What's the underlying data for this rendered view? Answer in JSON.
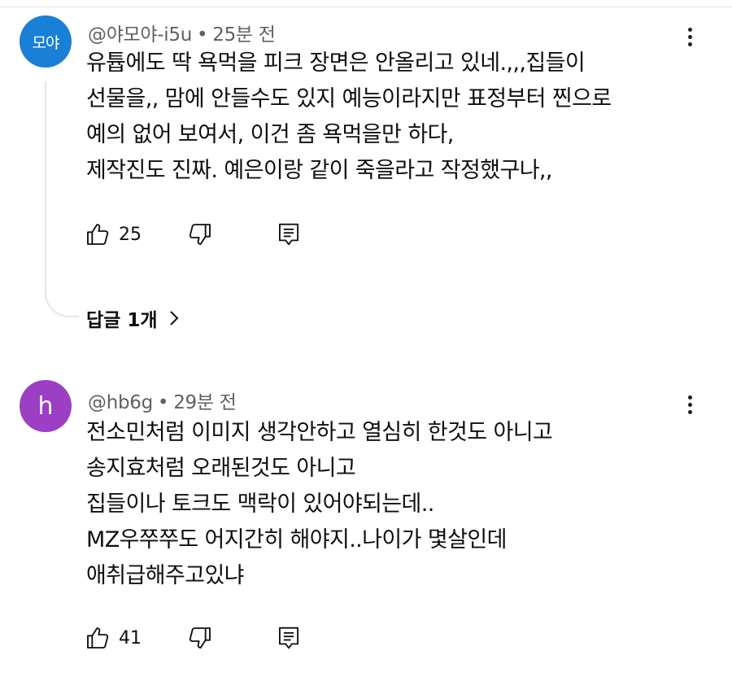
{
  "comments": [
    {
      "avatar_text": "모야",
      "author": "@야모야-i5u",
      "separator": "•",
      "time": "25분 전",
      "lines": [
        "유튭에도 딱 욕먹을 피크 장면은 안올리고 있네.,,,집들이",
        "선물을,, 맘에 안들수도 있지 예능이라지만 표정부터 찐으로",
        "예의 없어 보여서, 이건 좀 욕먹을만 하다,",
        "제작진도 진짜. 예은이랑 같이 죽을라고 작정했구나,,"
      ],
      "like_count": "25",
      "reply_label": "답글 1개",
      "colors": {
        "avatar": "#1a7fd6"
      }
    },
    {
      "avatar_text": "h",
      "author": "@hb6g",
      "separator": "•",
      "time": "29분 전",
      "lines": [
        "전소민처럼 이미지 생각안하고 열심히 한것도 아니고",
        "송지효처럼 오래된것도 아니고",
        "집들이나 토크도 맥락이 있어야되는데..",
        "MZ우쭈쭈도 어지간히 해야지..나이가 몇살인데",
        "애취급해주고있냐"
      ],
      "like_count": "41",
      "colors": {
        "avatar": "#9b3fc4"
      }
    }
  ],
  "icons": {
    "like": "thumbs-up-icon",
    "dislike": "thumbs-down-icon",
    "reply": "comment-reply-icon",
    "more": "more-vertical-icon",
    "chevron": "chevron-right-icon"
  }
}
